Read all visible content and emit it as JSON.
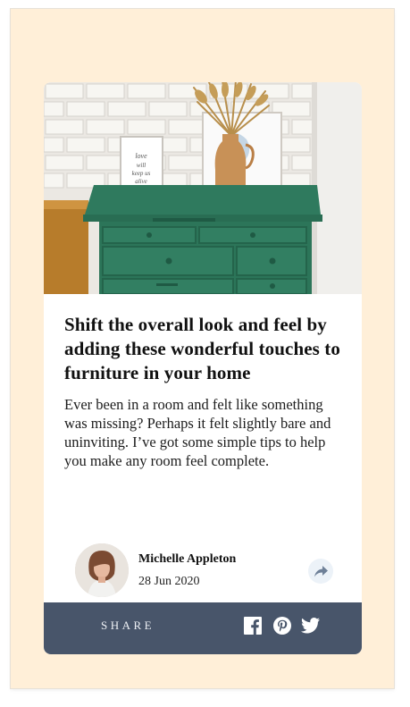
{
  "article": {
    "title": "Shift the overall look and feel by adding these wonderful touches to furniture in your home",
    "excerpt": "Ever been in a room and felt like something was missing? Perhaps it felt slightly bare and uninviting. I’ve got some simple tips to help you make any room feel complete.",
    "image_alt": "drawers",
    "frame_text": "love will keep us alive"
  },
  "author": {
    "name": "Michelle Appleton",
    "date": "28 Jun 2020"
  },
  "share": {
    "label": "SHARE",
    "icons": [
      "share-arrow-icon",
      "facebook-icon",
      "pinterest-icon",
      "twitter-icon"
    ]
  },
  "colors": {
    "page_bg": "#ffefd8",
    "card_bg": "#ffffff",
    "share_bar": "#48556a",
    "share_button_bg": "#ecf2f8",
    "share_arrow": "#6e8098",
    "dresser_green": "#2f7a5e"
  }
}
